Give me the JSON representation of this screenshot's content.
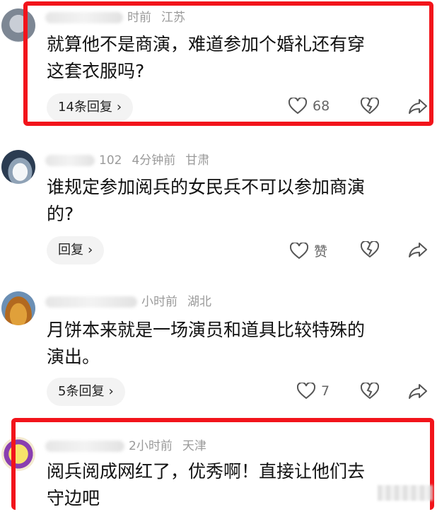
{
  "comments": [
    {
      "time": "时前",
      "location": "江苏",
      "text_lines": [
        "就算他不是商演，难道参加个婚礼还有穿",
        "这套衣服吗?"
      ],
      "reply_label": "14条回复",
      "like_count": "68",
      "highlighted": true
    },
    {
      "user_suffix": "102",
      "time": "4分钟前",
      "location": "甘肃",
      "text_lines": [
        "谁规定参加阅兵的女民兵不可以参加商演",
        "的?"
      ],
      "reply_label": "回复",
      "like_count": "赞",
      "highlighted": false
    },
    {
      "time": "小时前",
      "location": "湖北",
      "text_lines": [
        "月饼本来就是一场演员和道具比较特殊的",
        "演出。"
      ],
      "reply_label": "5条回复",
      "like_count": "7",
      "highlighted": false
    },
    {
      "time": "2小时前",
      "location": "天津",
      "text_lines": [
        "阅兵阅成网红了，优秀啊！直接让他们去",
        "守边吧"
      ],
      "highlighted": true
    }
  ],
  "icons": {
    "like": "heart-outline-icon",
    "dislike": "broken-heart-icon",
    "share": "share-arrow-icon",
    "chevron": "chevron-right-icon"
  },
  "colors": {
    "highlight_border": "#f2141b",
    "meta_text": "#9a9a9a",
    "chip_bg": "#f3f3f3"
  }
}
